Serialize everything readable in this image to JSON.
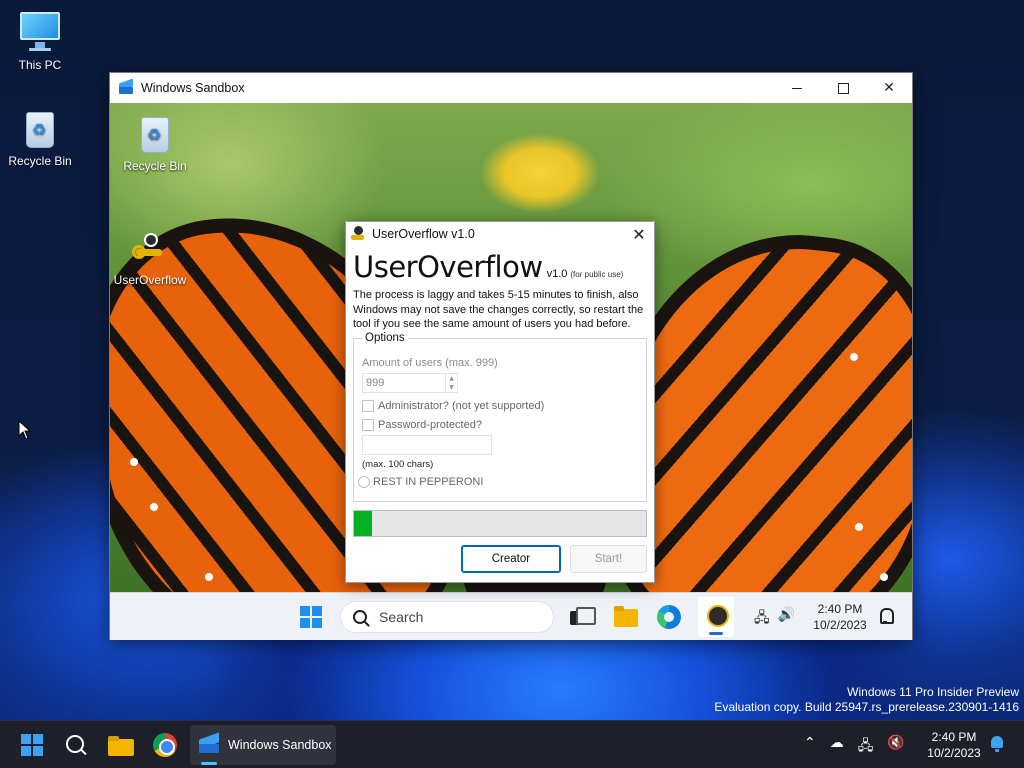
{
  "host_desktop": {
    "icons": [
      {
        "label": "This PC"
      },
      {
        "label": "Recycle Bin"
      }
    ],
    "watermark": {
      "line1": "Windows 11 Pro Insider Preview",
      "line2": "Evaluation copy. Build 25947.rs_prerelease.230901-1416"
    }
  },
  "sandbox_window": {
    "title": "Windows Sandbox",
    "controls": {
      "minimize": "minimize",
      "maximize": "maximize",
      "close": "✕"
    },
    "desktop_icons": [
      {
        "label": "Recycle Bin"
      },
      {
        "label": "UserOverflow"
      }
    ],
    "taskbar": {
      "search_placeholder": "Search",
      "tray_icons": [
        "network-icon",
        "volume-icon"
      ],
      "time": "2:40 PM",
      "date": "10/2/2023"
    }
  },
  "dialog": {
    "title": "UserOverflow v1.0",
    "close": "✕",
    "app_name": "UserOverflow",
    "version": "v1.0",
    "tag": "(for public use)",
    "description": "The process is laggy and takes 5-15 minutes to finish, also Windows may not save the changes correctly, so restart the tool if you see the same amount of users you had before.",
    "options": {
      "legend": "Options",
      "amount_label": "Amount of users (max. 999)",
      "amount_value": "999",
      "admin_checkbox": "Administrator? (not yet supported)",
      "password_checkbox": "Password-protected?",
      "password_value": "",
      "max_note": "(max. 100 chars)",
      "radio_label": "REST IN PEPPERONI"
    },
    "progress_percent": 6,
    "buttons": {
      "creator": "Creator",
      "start": "Start!"
    }
  },
  "host_taskbar": {
    "running_app": "Windows Sandbox",
    "time": "2:40 PM",
    "date": "10/2/2023"
  },
  "colors": {
    "accent": "#0067c0",
    "progress": "#06b025",
    "host_taskbar": "#1e2029"
  }
}
